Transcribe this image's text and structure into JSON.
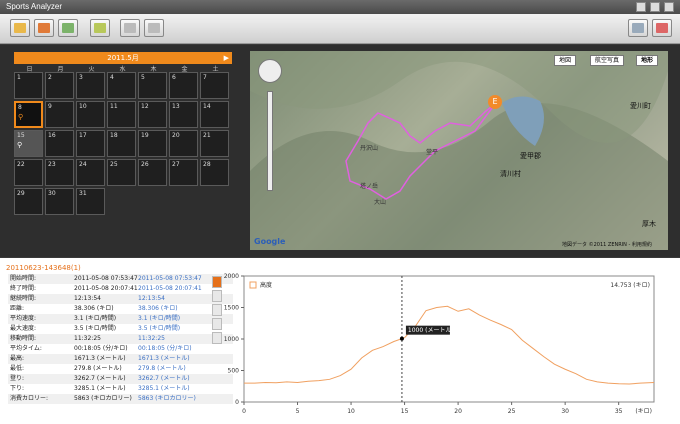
{
  "window": {
    "title": "Sports Analyzer"
  },
  "toolbar": {
    "buttons": [
      "import-icon",
      "calendar-icon",
      "export-icon",
      "settings-icon",
      "copy-icon",
      "page-icon",
      "window-icon",
      "help-icon"
    ]
  },
  "calendar": {
    "month": "2011.5月",
    "weekdays": [
      "日",
      "月",
      "火",
      "水",
      "木",
      "金",
      "土"
    ],
    "days": [
      {
        "n": "1",
        "w": ""
      },
      {
        "n": "2",
        "w": ""
      },
      {
        "n": "3",
        "w": ""
      },
      {
        "n": "4",
        "w": ""
      },
      {
        "n": "5",
        "w": ""
      },
      {
        "n": "6",
        "w": ""
      },
      {
        "n": "7",
        "w": ""
      },
      {
        "n": "8",
        "w": "⚲"
      },
      {
        "n": "9",
        "w": ""
      },
      {
        "n": "10",
        "w": ""
      },
      {
        "n": "11",
        "w": ""
      },
      {
        "n": "12",
        "w": ""
      },
      {
        "n": "13",
        "w": ""
      },
      {
        "n": "14",
        "w": ""
      },
      {
        "n": "15",
        "w": "⚲"
      },
      {
        "n": "16",
        "w": ""
      },
      {
        "n": "17",
        "w": ""
      },
      {
        "n": "18",
        "w": ""
      },
      {
        "n": "19",
        "w": ""
      },
      {
        "n": "20",
        "w": ""
      },
      {
        "n": "21",
        "w": ""
      },
      {
        "n": "22",
        "w": ""
      },
      {
        "n": "23",
        "w": ""
      },
      {
        "n": "24",
        "w": ""
      },
      {
        "n": "25",
        "w": ""
      },
      {
        "n": "26",
        "w": ""
      },
      {
        "n": "27",
        "w": ""
      },
      {
        "n": "28",
        "w": ""
      },
      {
        "n": "29",
        "w": ""
      },
      {
        "n": "30",
        "w": ""
      },
      {
        "n": "31",
        "w": ""
      }
    ]
  },
  "map": {
    "types": [
      "地図",
      "航空写真",
      "地形"
    ],
    "labels": [
      "愛川町",
      "清川村",
      "愛甲郡",
      "厚木",
      "丹沢山",
      "堂平",
      "塔ノ岳",
      "大山"
    ],
    "copyright": "地図データ ©2011 ZENRIN - 利用規約",
    "logo": "Google",
    "marker": "E"
  },
  "session": {
    "id": "20110623-143648(1)",
    "stats": [
      {
        "k": "開始時間:",
        "v1": "2011-05-08 07:53:47",
        "v2": "2011-05-08 07:53:47"
      },
      {
        "k": "終了時間:",
        "v1": "2011-05-08 20:07:41",
        "v2": "2011-05-08 20:07:41"
      },
      {
        "k": "継続時間:",
        "v1": "12:13:54",
        "v2": "12:13:54"
      },
      {
        "k": "距離:",
        "v1": "38.306 (キロ)",
        "v2": "38.306 (キロ)"
      },
      {
        "k": "平均速度:",
        "v1": "3.1 (キロ/時間)",
        "v2": "3.1 (キロ/時間)"
      },
      {
        "k": "最大速度:",
        "v1": "3.5 (キロ/時間)",
        "v2": "3.5 (キロ/時間)"
      },
      {
        "k": "移動時間:",
        "v1": "11:32:25",
        "v2": "11:32:25"
      },
      {
        "k": "平均タイム:",
        "v1": "00:18:05 (分/キロ)",
        "v2": "00:18:05 (分/キロ)"
      },
      {
        "k": "最高:",
        "v1": "1671.3 (メートル)",
        "v2": "1671.3 (メートル)"
      },
      {
        "k": "最低:",
        "v1": "279.8 (メートル)",
        "v2": "279.8 (メートル)"
      },
      {
        "k": "登り:",
        "v1": "3262.7 (メートル)",
        "v2": "3262.7 (メートル)"
      },
      {
        "k": "下り:",
        "v1": "3285.1 (メートル)",
        "v2": "3285.1 (メートル)"
      },
      {
        "k": "消費カロリー:",
        "v1": "5863 (キロカロリー)",
        "v2": "5863 (キロカロリー)"
      }
    ]
  },
  "chart_data": {
    "type": "line",
    "series": [
      {
        "name": "高度"
      }
    ],
    "legend": "top-left",
    "ylim": [
      0,
      2000
    ],
    "xlim": [
      0,
      38.3
    ],
    "yticks": [
      "0",
      "500",
      "1000",
      "1500",
      "2000"
    ],
    "xticks": [
      "0",
      "5",
      "10",
      "15",
      "20",
      "25",
      "30",
      "35"
    ],
    "xunit": "(キロ)",
    "readout": "14.753 (キロ)",
    "marker_label": "1000 (メートル)",
    "marker_x": 14.753,
    "color": "#f0a060",
    "x": [
      0,
      1,
      2,
      3,
      4,
      5,
      6,
      7,
      8,
      9,
      10,
      11,
      12,
      13,
      14,
      15,
      16,
      17,
      18,
      19,
      20,
      21,
      22,
      23,
      24,
      25,
      26,
      27,
      28,
      29,
      30,
      31,
      32,
      33,
      34,
      35,
      36,
      37,
      38.3
    ],
    "y": [
      300,
      300,
      310,
      305,
      320,
      310,
      330,
      340,
      360,
      420,
      520,
      700,
      820,
      880,
      960,
      1020,
      1200,
      1450,
      1500,
      1520,
      1440,
      1480,
      1380,
      1300,
      1230,
      1150,
      980,
      850,
      720,
      600,
      520,
      450,
      360,
      320,
      300,
      290,
      285,
      300,
      310
    ]
  }
}
